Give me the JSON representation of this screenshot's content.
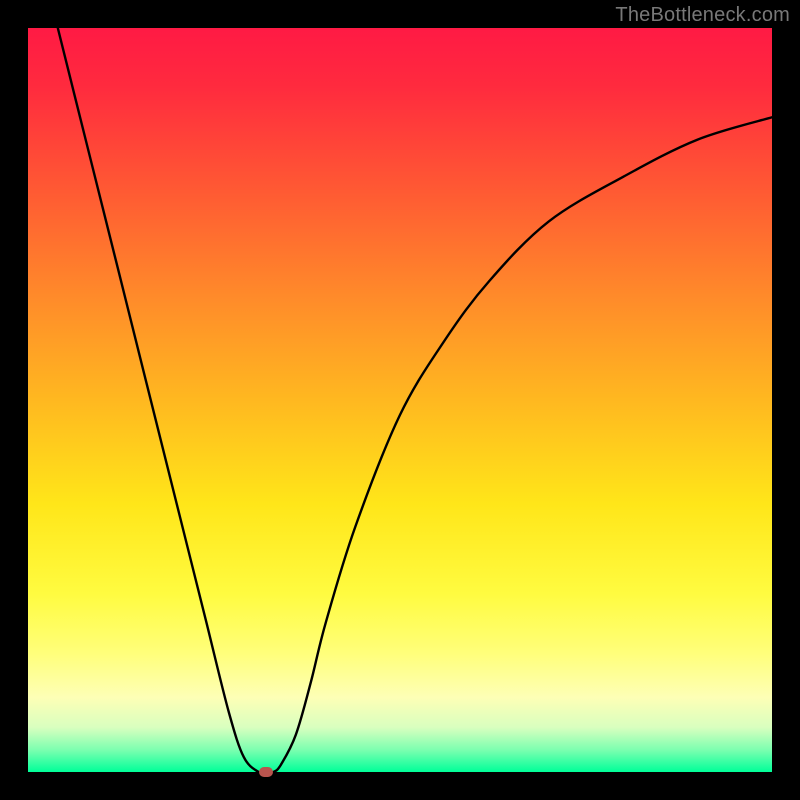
{
  "watermark": "TheBottleneck.com",
  "colors": {
    "frame": "#000000",
    "curve": "#000000",
    "marker": "#b9544e"
  },
  "chart_data": {
    "type": "line",
    "title": "",
    "xlabel": "",
    "ylabel": "",
    "xlim": [
      0,
      100
    ],
    "ylim": [
      0,
      100
    ],
    "grid": false,
    "legend": false,
    "series": [
      {
        "name": "bottleneck-curve",
        "x": [
          4,
          8,
          12,
          16,
          20,
          24,
          27,
          29,
          31,
          32,
          33,
          34,
          36,
          38,
          40,
          44,
          50,
          56,
          62,
          70,
          80,
          90,
          100
        ],
        "y": [
          100,
          84,
          68,
          52,
          36,
          20,
          8,
          2,
          0,
          0,
          0,
          1,
          5,
          12,
          20,
          33,
          48,
          58,
          66,
          74,
          80,
          85,
          88
        ]
      }
    ],
    "marker": {
      "x": 32,
      "y": 0
    },
    "background_gradient": {
      "direction": "top-to-bottom",
      "stops": [
        {
          "pos": 0,
          "color": "#ff1a44"
        },
        {
          "pos": 50,
          "color": "#ffb820"
        },
        {
          "pos": 84,
          "color": "#ffff7a"
        },
        {
          "pos": 100,
          "color": "#00ff99"
        }
      ]
    }
  }
}
